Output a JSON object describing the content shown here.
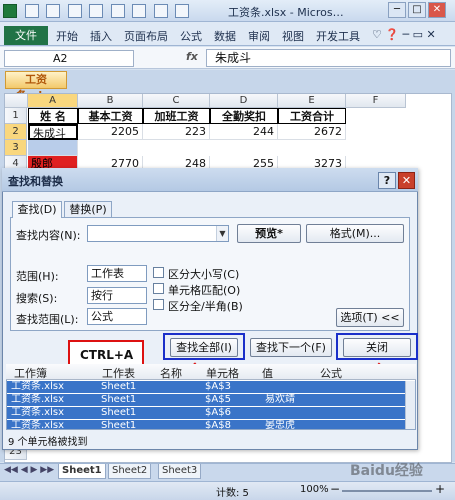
{
  "title_bar": {
    "title": "工资条.xlsx - Micros…",
    "min": "─",
    "max": "□",
    "close": "✕"
  },
  "ribbon": {
    "file_tab": "文件",
    "tabs": [
      "开始",
      "插入",
      "页面布局",
      "公式",
      "数据",
      "审阅",
      "视图",
      "开发工具"
    ]
  },
  "formula_bar": {
    "name_box": "A2",
    "fx": "fx",
    "content": "朱成斗"
  },
  "workbook_tab": "工资条.xlsx",
  "sheet": {
    "columns": [
      "A",
      "B",
      "C",
      "D",
      "E",
      "F"
    ],
    "rows": [
      "1",
      "2",
      "3",
      "4",
      "",
      "23"
    ],
    "headers": [
      "姓 名",
      "基本工资",
      "加班工资",
      "全勤奖扣",
      "工资合计"
    ],
    "row2": {
      "name": "朱成斗",
      "base": "2205",
      "ot": "223",
      "att": "244",
      "total": "2672"
    },
    "row4": {
      "name": "殷郎",
      "base": "2770",
      "ot": "248",
      "att": "255",
      "total": "3273"
    }
  },
  "dialog": {
    "title": "查找和替换",
    "help": "?",
    "close": "✕",
    "tabs": [
      "查找(D)",
      "替换(P)"
    ],
    "find_label": "查找内容(N):",
    "find_value": "",
    "preview_btn": "预览*",
    "format_btn": "格式(M)...",
    "within_label": "范围(H):",
    "within_value": "工作表",
    "search_label": "搜索(S):",
    "search_value": "按行",
    "lookin_label": "查找范围(L):",
    "lookin_value": "公式",
    "match_case": "区分大小写(C)",
    "match_cell": "单元格匹配(O)",
    "match_width": "区分全/半角(B)",
    "options_btn": "选项(T) <<",
    "find_all_btn": "查找全部(I)",
    "find_next_btn": "查找下一个(F)",
    "close_btn": "关闭",
    "annotation": "CTRL+A",
    "results_headers": [
      "工作簿",
      "工作表",
      "名称",
      "单元格",
      "值",
      "公式"
    ],
    "results": [
      {
        "book": "工资条.xlsx",
        "sheet": "Sheet1",
        "cell": "$A$3",
        "value": ""
      },
      {
        "book": "工资条.xlsx",
        "sheet": "Sheet1",
        "cell": "$A$5",
        "value": "易欢靖"
      },
      {
        "book": "工资条.xlsx",
        "sheet": "Sheet1",
        "cell": "$A$6",
        "value": ""
      },
      {
        "book": "工资条.xlsx",
        "sheet": "Sheet1",
        "cell": "$A$8",
        "value": "晏忠虎"
      }
    ],
    "status": "9 个单元格被找到"
  },
  "sheet_tabs": [
    "Sheet1",
    "Sheet2",
    "Sheet3"
  ],
  "status_bar": {
    "count": "计数: 5",
    "zoom": "100%",
    "minus": "−",
    "plus": "+"
  },
  "watermark": "Baidu经验"
}
